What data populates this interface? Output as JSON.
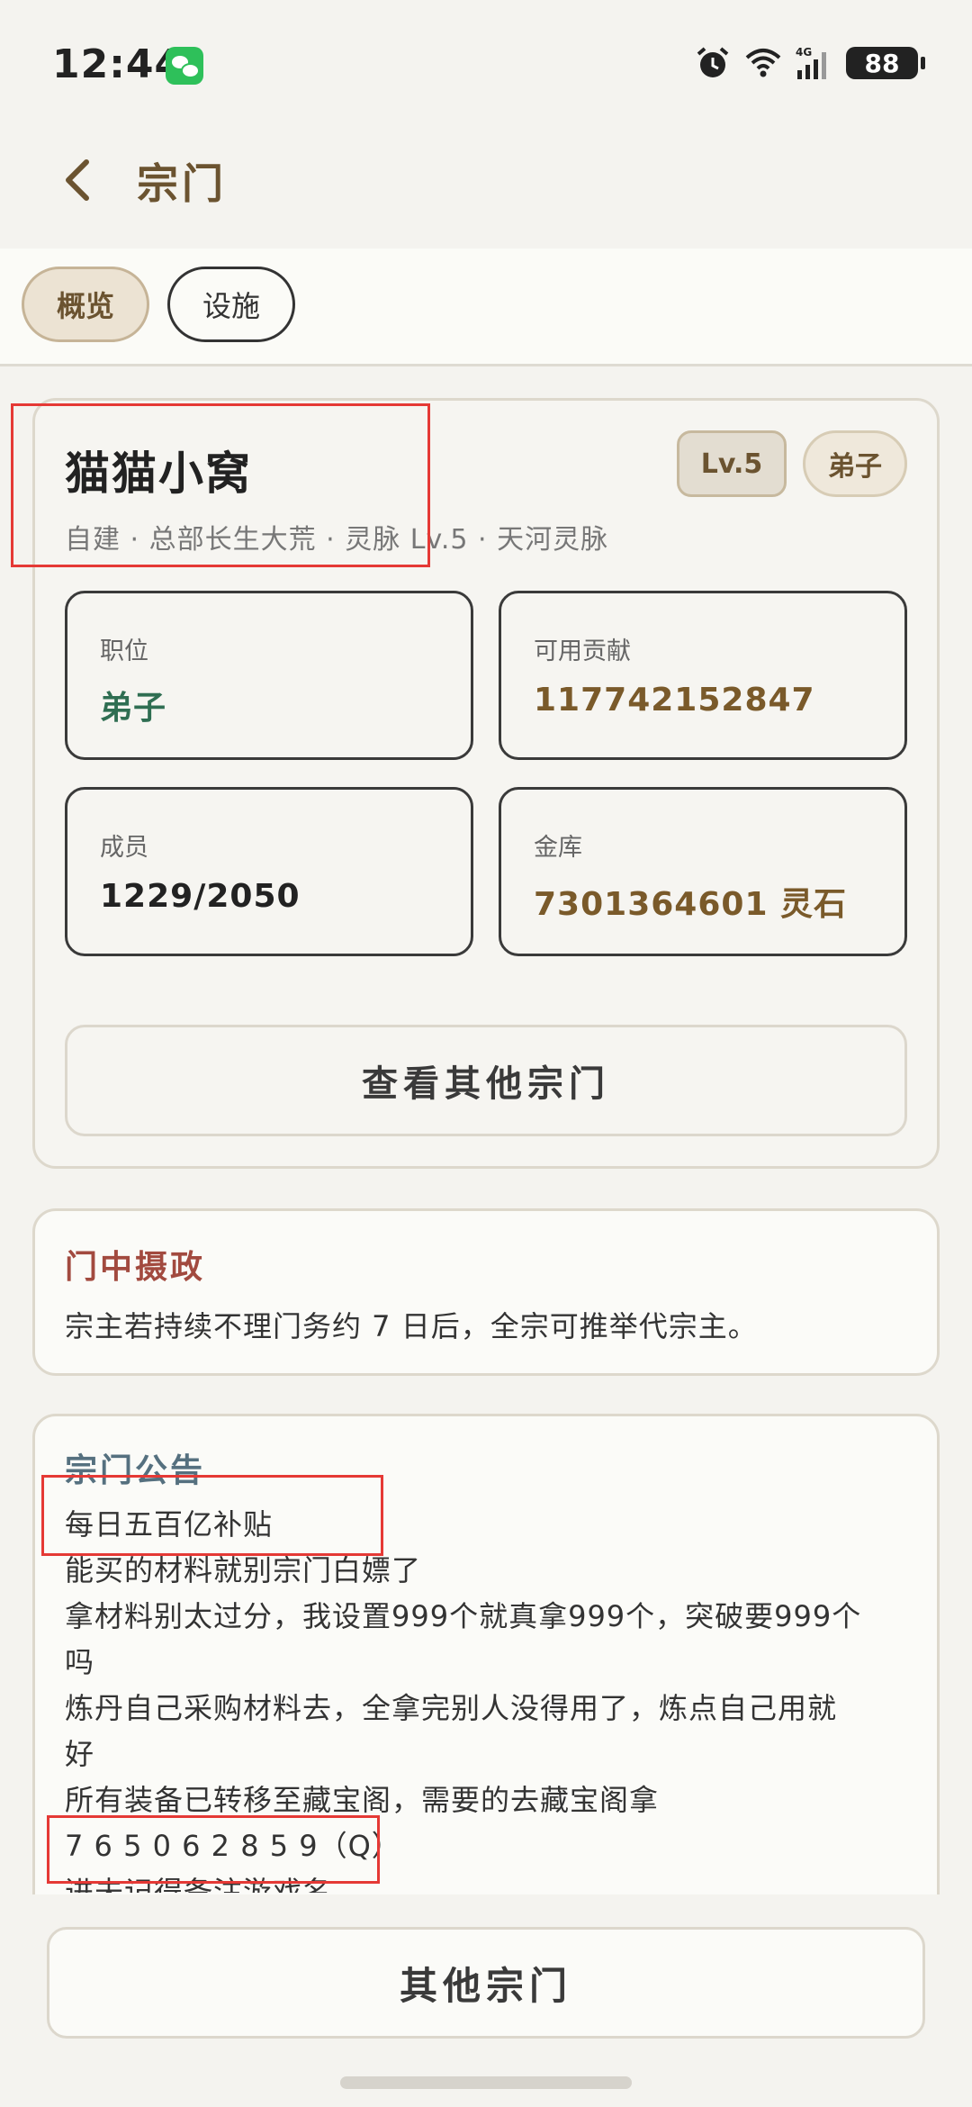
{
  "status_bar": {
    "time": "12:44",
    "battery": "88",
    "network": "4G",
    "icons": [
      "wechat-icon",
      "alarm-icon",
      "wifi-icon",
      "signal-icon",
      "battery-icon"
    ]
  },
  "header": {
    "title": "宗门",
    "back_icon": "chevron-left-icon"
  },
  "tabs": [
    {
      "label": "概览",
      "active": true
    },
    {
      "label": "设施",
      "active": false
    }
  ],
  "sect": {
    "name": "猫猫小窝",
    "level_badge": "Lv.5",
    "role_badge": "弟子",
    "meta": "自建 · 总部长生大荒 · 灵脉 Lv.5 · 天河灵脉",
    "stats": [
      {
        "label": "职位",
        "value": "弟子"
      },
      {
        "label": "可用贡献",
        "value": "117742152847"
      },
      {
        "label": "成员",
        "value": "1229/2050"
      },
      {
        "label": "金库",
        "value": "7301364601 灵石"
      }
    ],
    "view_others_label": "查看其他宗门"
  },
  "regency": {
    "title": "门中摄政",
    "text": "宗主若持续不理门务约 7 日后，全宗可推举代宗主。"
  },
  "announcement": {
    "title": "宗门公告",
    "lines": [
      "每日五百亿补贴",
      "能买的材料就别宗门白嫖了",
      "拿材料别太过分，我设置999个就真拿999个，突破要999个",
      "吗",
      "炼丹自己采购材料去，全拿完别人没得用了，炼点自己用就",
      "好",
      "所有装备已转移至藏宝阁，需要的去藏宝阁拿",
      "7 6 5 0 6 2 8 5 9（Q）",
      "进未记得备注游戏名"
    ]
  },
  "footer": {
    "other_sects_label": "其他宗门"
  },
  "colors": {
    "accent_brown": "#6b5330",
    "green_value": "#2f6e52",
    "red_title": "#a24a3f",
    "blue_title": "#55707f",
    "highlight_red": "#e53935"
  }
}
